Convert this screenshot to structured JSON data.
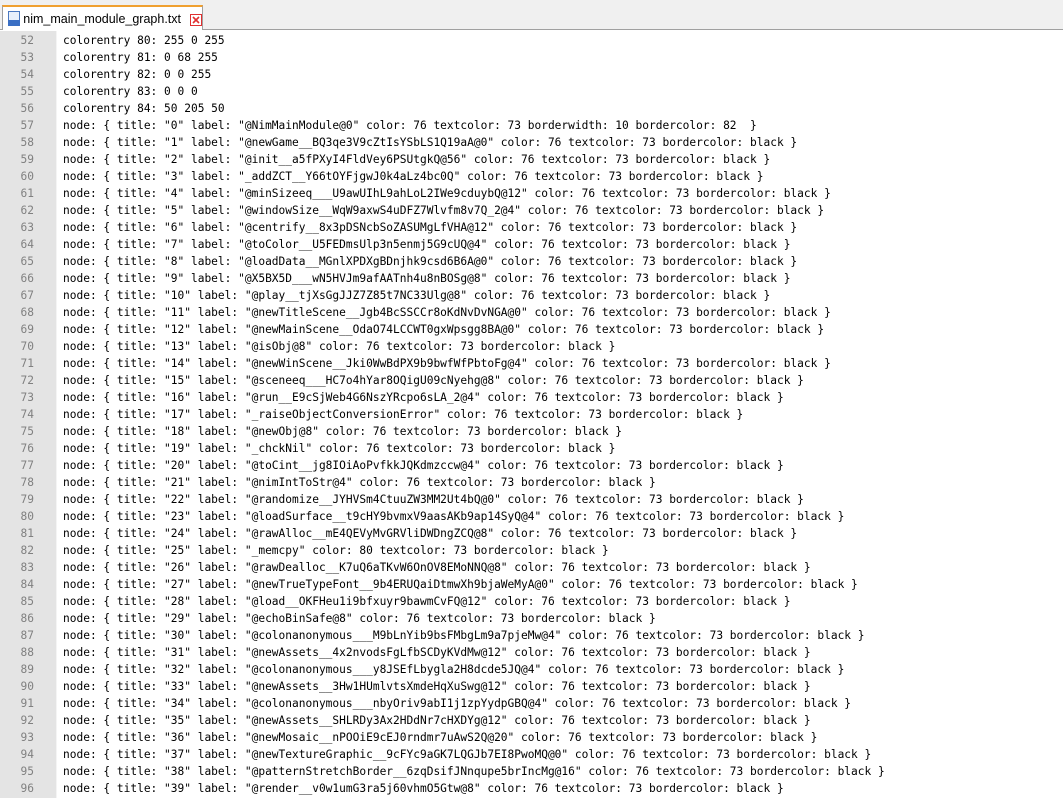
{
  "tab": {
    "filename": "nim_main_module_graph.txt"
  },
  "lines": [
    {
      "n": "52",
      "text": "colorentry 80: 255 0 255"
    },
    {
      "n": "53",
      "text": "colorentry 81: 0 68 255"
    },
    {
      "n": "54",
      "text": "colorentry 82: 0 0 255"
    },
    {
      "n": "55",
      "text": "colorentry 83: 0 0 0"
    },
    {
      "n": "56",
      "text": "colorentry 84: 50 205 50"
    },
    {
      "n": "57",
      "text": "node: { title: \"0\" label: \"@NimMainModule@0\" color: 76 textcolor: 73 borderwidth: 10 bordercolor: 82  }"
    },
    {
      "n": "58",
      "text": "node: { title: \"1\" label: \"@newGame__BQ3qe3V9cZtIsYSbLS1Q19aA@0\" color: 76 textcolor: 73 bordercolor: black }"
    },
    {
      "n": "59",
      "text": "node: { title: \"2\" label: \"@init__a5fPXyI4FldVey6PSUtgkQ@56\" color: 76 textcolor: 73 bordercolor: black }"
    },
    {
      "n": "60",
      "text": "node: { title: \"3\" label: \"_addZCT__Y66tOYFjgwJ0k4aLz4bc0Q\" color: 76 textcolor: 73 bordercolor: black }"
    },
    {
      "n": "61",
      "text": "node: { title: \"4\" label: \"@minSizeeq___U9awUIhL9ahLoL2IWe9cduybQ@12\" color: 76 textcolor: 73 bordercolor: black }"
    },
    {
      "n": "62",
      "text": "node: { title: \"5\" label: \"@windowSize__WqW9axwS4uDFZ7Wlvfm8v7Q_2@4\" color: 76 textcolor: 73 bordercolor: black }"
    },
    {
      "n": "63",
      "text": "node: { title: \"6\" label: \"@centrify__8x3pDSNcbSoZASUMgLfVHA@12\" color: 76 textcolor: 73 bordercolor: black }"
    },
    {
      "n": "64",
      "text": "node: { title: \"7\" label: \"@toColor__U5FEDmsUlp3n5enmj5G9cUQ@4\" color: 76 textcolor: 73 bordercolor: black }"
    },
    {
      "n": "65",
      "text": "node: { title: \"8\" label: \"@loadData__MGnlXPDXgBDnjhk9csd6B6A@0\" color: 76 textcolor: 73 bordercolor: black }"
    },
    {
      "n": "66",
      "text": "node: { title: \"9\" label: \"@X5BX5D___wN5HVJm9afAATnh4u8nBOSg@8\" color: 76 textcolor: 73 bordercolor: black }"
    },
    {
      "n": "67",
      "text": "node: { title: \"10\" label: \"@play__tjXsGgJJZ7Z85t7NC33Ulg@8\" color: 76 textcolor: 73 bordercolor: black }"
    },
    {
      "n": "68",
      "text": "node: { title: \"11\" label: \"@newTitleScene__Jgb4BcSSCCr8oKdNvDvNGA@0\" color: 76 textcolor: 73 bordercolor: black }"
    },
    {
      "n": "69",
      "text": "node: { title: \"12\" label: \"@newMainScene__OdaO74LCCWT0gxWpsgg8BA@0\" color: 76 textcolor: 73 bordercolor: black }"
    },
    {
      "n": "70",
      "text": "node: { title: \"13\" label: \"@isObj@8\" color: 76 textcolor: 73 bordercolor: black }"
    },
    {
      "n": "71",
      "text": "node: { title: \"14\" label: \"@newWinScene__Jki0WwBdPX9b9bwfWfPbtoFg@4\" color: 76 textcolor: 73 bordercolor: black }"
    },
    {
      "n": "72",
      "text": "node: { title: \"15\" label: \"@sceneeq___HC7o4hYar8OQigU09cNyehg@8\" color: 76 textcolor: 73 bordercolor: black }"
    },
    {
      "n": "73",
      "text": "node: { title: \"16\" label: \"@run__E9cSjWeb4G6NszYRcpo6sLA_2@4\" color: 76 textcolor: 73 bordercolor: black }"
    },
    {
      "n": "74",
      "text": "node: { title: \"17\" label: \"_raiseObjectConversionError\" color: 76 textcolor: 73 bordercolor: black }"
    },
    {
      "n": "75",
      "text": "node: { title: \"18\" label: \"@newObj@8\" color: 76 textcolor: 73 bordercolor: black }"
    },
    {
      "n": "76",
      "text": "node: { title: \"19\" label: \"_chckNil\" color: 76 textcolor: 73 bordercolor: black }"
    },
    {
      "n": "77",
      "text": "node: { title: \"20\" label: \"@toCint__jg8IOiAoPvfkkJQKdmzccw@4\" color: 76 textcolor: 73 bordercolor: black }"
    },
    {
      "n": "78",
      "text": "node: { title: \"21\" label: \"@nimIntToStr@4\" color: 76 textcolor: 73 bordercolor: black }"
    },
    {
      "n": "79",
      "text": "node: { title: \"22\" label: \"@randomize__JYHVSm4CtuuZW3MM2Ut4bQ@0\" color: 76 textcolor: 73 bordercolor: black }"
    },
    {
      "n": "80",
      "text": "node: { title: \"23\" label: \"@loadSurface__t9cHY9bvmxV9aasAKb9ap14SyQ@4\" color: 76 textcolor: 73 bordercolor: black }"
    },
    {
      "n": "81",
      "text": "node: { title: \"24\" label: \"@rawAlloc__mE4QEVyMvGRVliDWDngZCQ@8\" color: 76 textcolor: 73 bordercolor: black }"
    },
    {
      "n": "82",
      "text": "node: { title: \"25\" label: \"_memcpy\" color: 80 textcolor: 73 bordercolor: black }"
    },
    {
      "n": "83",
      "text": "node: { title: \"26\" label: \"@rawDealloc__K7uQ6aTKvW6OnOV8EMoNNQ@8\" color: 76 textcolor: 73 bordercolor: black }"
    },
    {
      "n": "84",
      "text": "node: { title: \"27\" label: \"@newTrueTypeFont__9b4ERUQaiDtmwXh9bjaWeMyA@0\" color: 76 textcolor: 73 bordercolor: black }"
    },
    {
      "n": "85",
      "text": "node: { title: \"28\" label: \"@load__OKFHeu1i9bfxuyr9bawmCvFQ@12\" color: 76 textcolor: 73 bordercolor: black }"
    },
    {
      "n": "86",
      "text": "node: { title: \"29\" label: \"@echoBinSafe@8\" color: 76 textcolor: 73 bordercolor: black }"
    },
    {
      "n": "87",
      "text": "node: { title: \"30\" label: \"@colonanonymous___M9bLnYib9bsFMbgLm9a7pjeMw@4\" color: 76 textcolor: 73 bordercolor: black }"
    },
    {
      "n": "88",
      "text": "node: { title: \"31\" label: \"@newAssets__4x2nvodsFgLfbSCDyKVdMw@12\" color: 76 textcolor: 73 bordercolor: black }"
    },
    {
      "n": "89",
      "text": "node: { title: \"32\" label: \"@colonanonymous___y8JSEfLbygla2H8dcde5JQ@4\" color: 76 textcolor: 73 bordercolor: black }"
    },
    {
      "n": "90",
      "text": "node: { title: \"33\" label: \"@newAssets__3Hw1HUmlvtsXmdeHqXuSwg@12\" color: 76 textcolor: 73 bordercolor: black }"
    },
    {
      "n": "91",
      "text": "node: { title: \"34\" label: \"@colonanonymous___nbyOriv9abI1j1zpYydpGBQ@4\" color: 76 textcolor: 73 bordercolor: black }"
    },
    {
      "n": "92",
      "text": "node: { title: \"35\" label: \"@newAssets__SHLRDy3Ax2HDdNr7cHXDYg@12\" color: 76 textcolor: 73 bordercolor: black }"
    },
    {
      "n": "93",
      "text": "node: { title: \"36\" label: \"@newMosaic__nPOOiE9cEJ0rndmr7uAwS2Q@20\" color: 76 textcolor: 73 bordercolor: black }"
    },
    {
      "n": "94",
      "text": "node: { title: \"37\" label: \"@newTextureGraphic__9cFYc9aGK7LQGJb7EI8PwoMQ@0\" color: 76 textcolor: 73 bordercolor: black }"
    },
    {
      "n": "95",
      "text": "node: { title: \"38\" label: \"@patternStretchBorder__6zqDsifJNnqupe5brIncMg@16\" color: 76 textcolor: 73 bordercolor: black }"
    },
    {
      "n": "96",
      "text": "node: { title: \"39\" label: \"@render__v0w1umG3ra5j60vhmO5Gtw@8\" color: 76 textcolor: 73 bordercolor: black }"
    }
  ],
  "icons": {
    "file": "text-file-icon",
    "close": "close-icon"
  },
  "colors": {
    "tab_close": "#e03030",
    "line_numbers": "#808080",
    "gutter": "#e4e4e4"
  }
}
